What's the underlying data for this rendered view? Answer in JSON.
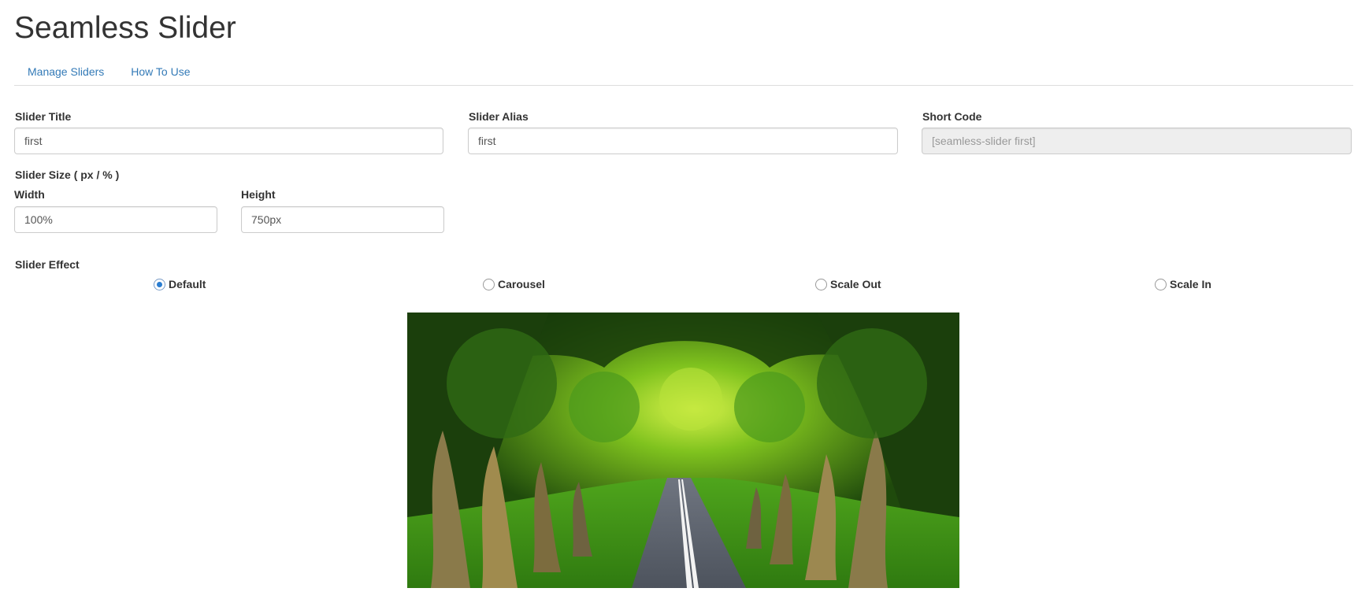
{
  "header": {
    "title": "Seamless Slider"
  },
  "nav": {
    "tabs": [
      {
        "label": "Manage Sliders"
      },
      {
        "label": "How To Use"
      }
    ]
  },
  "form": {
    "slider_title": {
      "label": "Slider Title",
      "value": "first"
    },
    "slider_alias": {
      "label": "Slider Alias",
      "value": "first"
    },
    "short_code": {
      "label": "Short Code",
      "value": "[seamless-slider first]"
    },
    "slider_size_label": "Slider Size ( px / % )",
    "width": {
      "label": "Width",
      "value": "100%"
    },
    "height": {
      "label": "Height",
      "value": "750px"
    },
    "effect": {
      "label": "Slider Effect",
      "options": [
        {
          "label": "Default",
          "selected": true
        },
        {
          "label": "Carousel",
          "selected": false
        },
        {
          "label": "Scale Out",
          "selected": false
        },
        {
          "label": "Scale In",
          "selected": false
        }
      ]
    }
  },
  "colors": {
    "link": "#337ab7",
    "radio_selected": "#2a7dd1",
    "readonly_bg": "#eeeeee"
  }
}
